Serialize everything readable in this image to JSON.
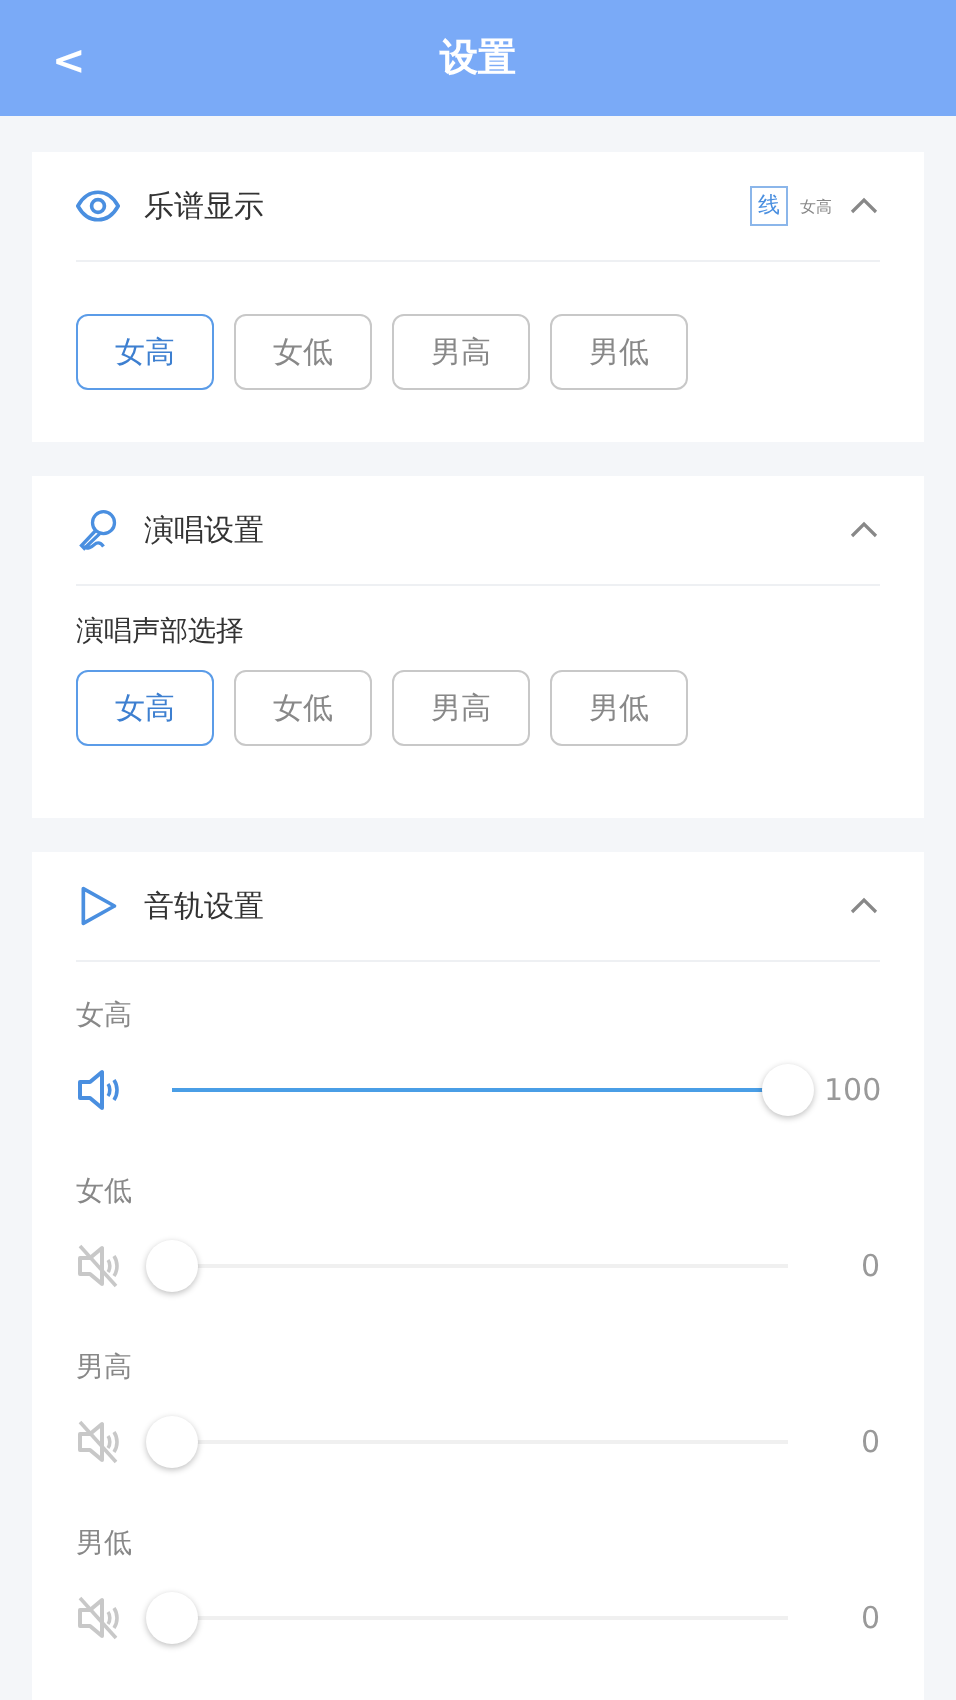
{
  "header": {
    "back": "<",
    "title": "设置"
  },
  "sections": [
    {
      "kind": "voices",
      "title": "乐谱显示",
      "expanded": true,
      "badge": {
        "glyph": "线",
        "text": "女高"
      },
      "options": [
        {
          "label": "女高",
          "selected": true
        },
        {
          "label": "女低",
          "selected": false
        },
        {
          "label": "男高",
          "selected": false
        },
        {
          "label": "男低",
          "selected": false
        }
      ]
    },
    {
      "kind": "voices",
      "title": "演唱设置",
      "expanded": true,
      "label": "演唱声部选择",
      "options": [
        {
          "label": "女高",
          "selected": true
        },
        {
          "label": "女低",
          "selected": false
        },
        {
          "label": "男高",
          "selected": false
        },
        {
          "label": "男低",
          "selected": false
        }
      ]
    },
    {
      "kind": "tracks",
      "title": "音轨设置",
      "expanded": true,
      "tracks": [
        {
          "name": "女高",
          "muted": false,
          "level": 1,
          "reading": "100"
        },
        {
          "name": "女低",
          "muted": true,
          "level": 0,
          "reading": "0"
        },
        {
          "name": "男高",
          "muted": true,
          "level": 0,
          "reading": "0"
        },
        {
          "name": "男低",
          "muted": true,
          "level": 0,
          "reading": "0"
        }
      ]
    }
  ]
}
